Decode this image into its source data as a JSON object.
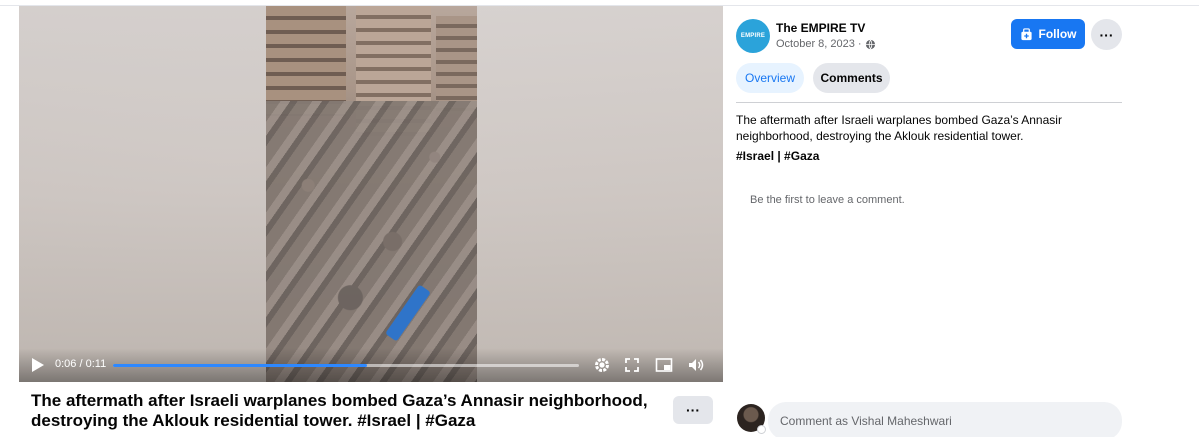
{
  "video": {
    "current_time": "0:06",
    "duration": "0:11",
    "progress_fraction": 0.545,
    "accent_color": "#2d88ff"
  },
  "post": {
    "title": "The aftermath after Israeli warplanes bombed Gaza’s Annasir neighborhood, destroying the Aklouk residential tower. #Israel | #Gaza",
    "more_label": "···"
  },
  "sidebar": {
    "avatar_text": "EMPIRE",
    "page_name": "The EMPIRE TV",
    "date": "October 8, 2023",
    "separator": "·",
    "follow_label": "Follow",
    "more_label": "···",
    "tabs": [
      {
        "label": "Overview"
      },
      {
        "label": "Comments"
      }
    ],
    "description": "The aftermath after Israeli warplanes bombed Gaza’s Annasir neighborhood, destroying the Aklouk residential tower.",
    "tags": "#Israel | #Gaza",
    "empty_comments": "Be the first to leave a comment.",
    "comment_placeholder": "Comment as Vishal Maheshwari",
    "brand_color": "#1877f2"
  }
}
